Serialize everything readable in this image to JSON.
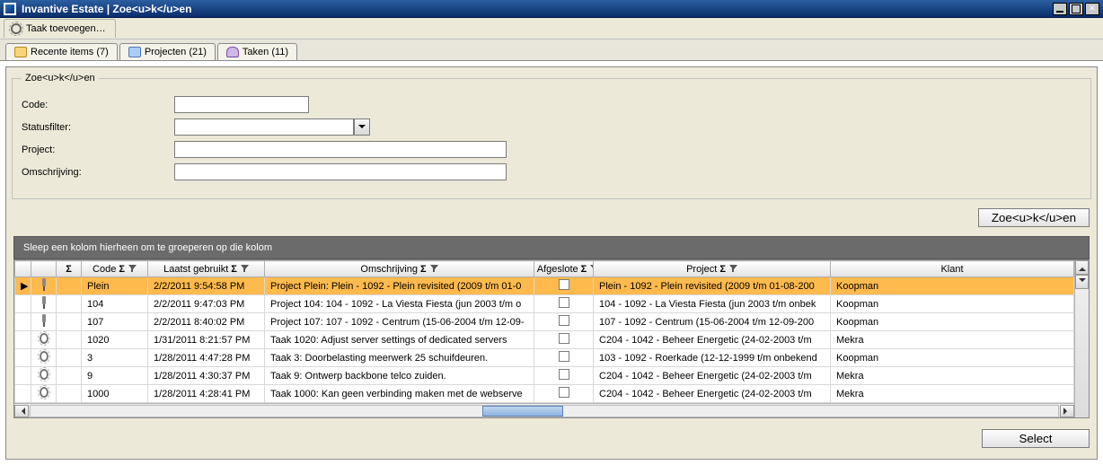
{
  "title": "Invantive Estate | Zoe<u>k</u>en",
  "toolbar": {
    "add_task": "Taak toevoegen…"
  },
  "tabs": {
    "recent": "Recente items (7)",
    "projects": "Projecten (21)",
    "tasks": "Taken (11)"
  },
  "search": {
    "legend": "Zoe<u>k</u>en",
    "code_label": "Code:",
    "status_label": "Statusfilter:",
    "project_label": "Project:",
    "desc_label": "Omschrijving:",
    "code_value": "",
    "status_value": "",
    "project_value": "",
    "desc_value": "",
    "button": "Zoe<u>k</u>en"
  },
  "grid": {
    "group_hint": "Sleep een kolom hierheen om te groeperen op die kolom",
    "headers": {
      "code": "Code",
      "last_used": "Laatst gebruikt",
      "desc": "Omschrijving",
      "closed": "Afgeslote",
      "project": "Project",
      "klant": "Klant"
    },
    "rows": [
      {
        "sel": true,
        "icon": "pin",
        "code": "Plein",
        "last": "2/2/2011 9:54:58 PM",
        "desc": "Project Plein: Plein - 1092 - Plein revisited (2009 t/m 01-0",
        "closed": false,
        "project": "Plein - 1092 - Plein revisited (2009 t/m 01-08-200",
        "klant": "Koopman"
      },
      {
        "sel": false,
        "icon": "pin",
        "code": "104",
        "last": "2/2/2011 9:47:03 PM",
        "desc": "Project 104: 104 - 1092 - La Viesta Fiesta (jun 2003 t/m o",
        "closed": false,
        "project": "104 - 1092 - La Viesta Fiesta (jun 2003 t/m onbek",
        "klant": "Koopman"
      },
      {
        "sel": false,
        "icon": "pin",
        "code": "107",
        "last": "2/2/2011 8:40:02 PM",
        "desc": "Project 107: 107 - 1092 - Centrum (15-06-2004 t/m 12-09-",
        "closed": false,
        "project": "107 - 1092 - Centrum (15-06-2004 t/m 12-09-200",
        "klant": "Koopman"
      },
      {
        "sel": false,
        "icon": "gear",
        "code": "1020",
        "last": "1/31/2011 8:21:57 PM",
        "desc": "Taak 1020: Adjust server settings of dedicated servers",
        "closed": false,
        "project": "C204 - 1042 - Beheer Energetic (24-02-2003 t/m",
        "klant": "Mekra"
      },
      {
        "sel": false,
        "icon": "gear",
        "code": "3",
        "last": "1/28/2011 4:47:28 PM",
        "desc": "Taak 3: Doorbelasting meerwerk 25 schuifdeuren.",
        "closed": false,
        "project": "103 - 1092 - Roerkade (12-12-1999 t/m onbekend",
        "klant": "Koopman"
      },
      {
        "sel": false,
        "icon": "gear",
        "code": "9",
        "last": "1/28/2011 4:30:37 PM",
        "desc": "Taak 9: Ontwerp backbone telco zuiden.",
        "closed": false,
        "project": "C204 - 1042 - Beheer Energetic (24-02-2003 t/m",
        "klant": "Mekra"
      },
      {
        "sel": false,
        "icon": "gear",
        "code": "1000",
        "last": "1/28/2011 4:28:41 PM",
        "desc": "Taak 1000: Kan geen verbinding maken met de webserve",
        "closed": false,
        "project": "C204 - 1042 - Beheer Energetic (24-02-2003 t/m",
        "klant": "Mekra"
      }
    ]
  },
  "footer": {
    "select": "Select"
  }
}
